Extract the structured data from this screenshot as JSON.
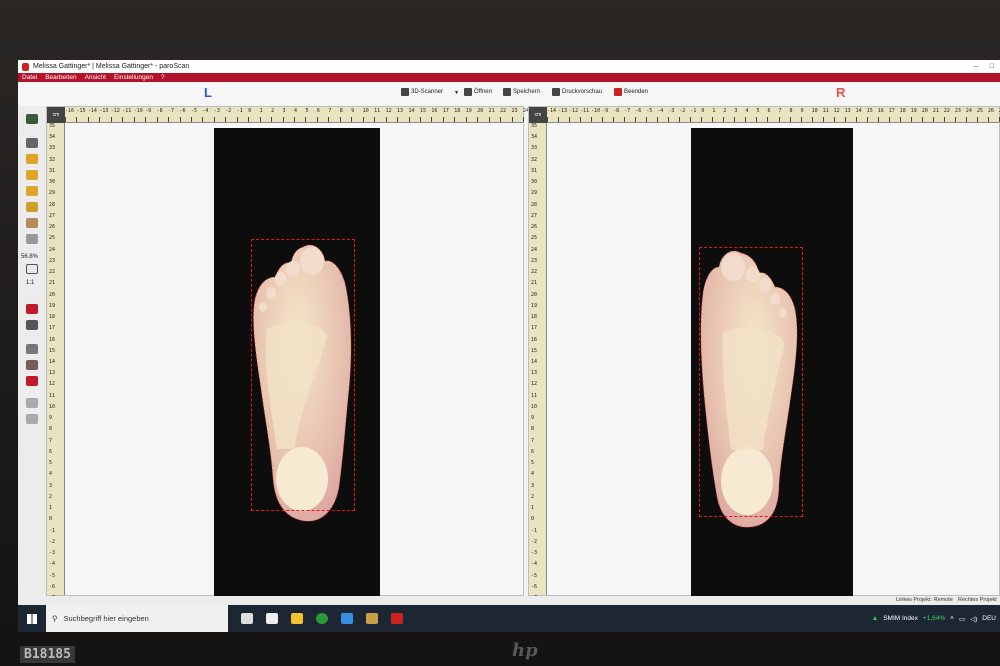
{
  "window": {
    "title": "Melissa Gattinger* | Melissa Gattinger* - paroScan"
  },
  "menu": [
    "Datei",
    "Bearbeiten",
    "Ansicht",
    "Einstellungen",
    "?"
  ],
  "toolbar": {
    "scanner": "3D-Scanner",
    "open": "Öffnen",
    "save": "Speichern",
    "print_preview": "Druckvorschau",
    "exit": "Beenden",
    "left_label": "L",
    "right_label": "R"
  },
  "zoom": {
    "percent": "56.8%",
    "one_to_one": "1:1"
  },
  "ruler_unit": "cm",
  "status": {
    "left_project": "Linkes Projekt: Remote",
    "right_project": "Rechtes Projekt"
  },
  "taskbar": {
    "search_placeholder": "Suchbegriff hier eingeben",
    "stock_name": "SMIM Index",
    "stock_change": "+1,64%",
    "language": "DEU"
  },
  "monitor": {
    "asset_tag": "B18185",
    "brand": "hp"
  },
  "colors": {
    "menubar": "#b3132a",
    "outline": "#e31b1b",
    "left_accent": "#2a5bd7",
    "right_accent": "#e0554a"
  }
}
